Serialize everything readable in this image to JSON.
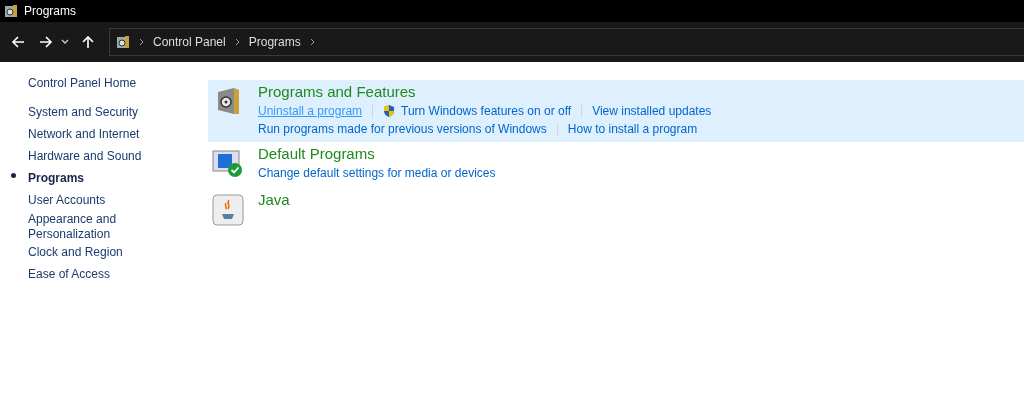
{
  "window": {
    "title": "Programs"
  },
  "address_bar": {
    "breadcrumbs": [
      "Control Panel",
      "Programs"
    ]
  },
  "sidebar": {
    "home": "Control Panel Home",
    "items": [
      {
        "label": "System and Security",
        "selected": false
      },
      {
        "label": "Network and Internet",
        "selected": false
      },
      {
        "label": "Hardware and Sound",
        "selected": false
      },
      {
        "label": "Programs",
        "selected": true
      },
      {
        "label": "User Accounts",
        "selected": false
      },
      {
        "label": "Appearance and Personalization",
        "selected": false
      },
      {
        "label": "Clock and Region",
        "selected": false
      },
      {
        "label": "Ease of Access",
        "selected": false
      }
    ]
  },
  "sections": [
    {
      "kind": "programs",
      "title": "Programs and Features",
      "highlighted": true,
      "link_rows": [
        [
          {
            "label": "Uninstall a program",
            "hovered": true,
            "shield": false
          },
          {
            "label": "Turn Windows features on or off",
            "hovered": false,
            "shield": true
          },
          {
            "label": "View installed updates",
            "hovered": false,
            "shield": false
          }
        ],
        [
          {
            "label": "Run programs made for previous versions of Windows",
            "hovered": false,
            "shield": false
          },
          {
            "label": "How to install a program",
            "hovered": false,
            "shield": false
          }
        ]
      ]
    },
    {
      "kind": "defaults",
      "title": "Default Programs",
      "highlighted": false,
      "link_rows": [
        [
          {
            "label": "Change default settings for media or devices",
            "hovered": false,
            "shield": false
          }
        ]
      ]
    },
    {
      "kind": "java",
      "title": "Java",
      "highlighted": false
    }
  ]
}
